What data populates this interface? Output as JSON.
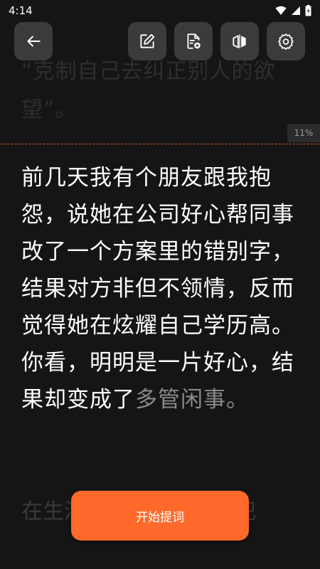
{
  "status_bar": {
    "time": "4:14"
  },
  "toolbar": {
    "back": "back-arrow-icon",
    "edit": "edit-pencil-icon",
    "doc": "document-icon",
    "mirror": "mirror-flip-icon",
    "settings": "gear-icon"
  },
  "reader": {
    "faded_top": "“克制自己去纠正别人的欲望”。",
    "progress": "11%",
    "main_bright": "前几天我有个朋友跟我抱怨，说她在公司好心帮同事改了一个方案里的错别字，结果对方非但不领情，反而觉得她在炫耀自己学历高。你看，明明是一片好心，结果却变成了",
    "main_dim": "多管闲事。",
    "faded_bottom": "在生活中，我们很容易犯"
  },
  "start_button": {
    "label": "开始提词"
  },
  "colors": {
    "accent": "#ff6a2b",
    "background": "#151515",
    "button_bg": "#3b3b3b"
  }
}
